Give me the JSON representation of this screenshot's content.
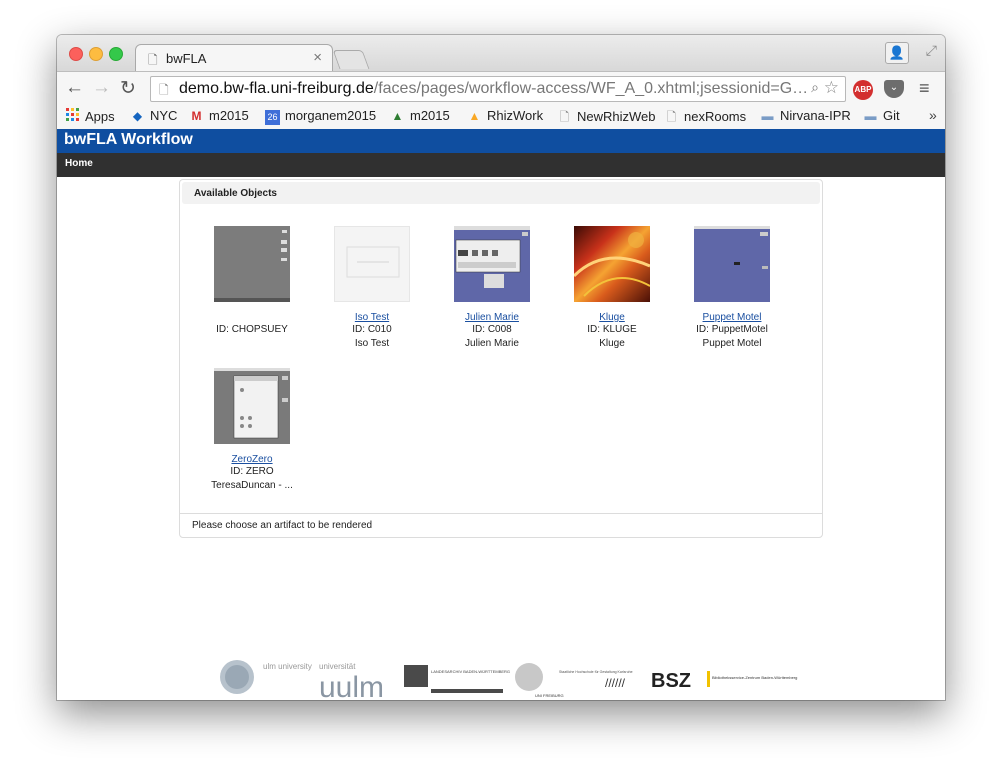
{
  "browser": {
    "tab_title": "bwFLA",
    "url_host": "demo.bw-fla.uni-freiburg.de",
    "url_path": "/faces/pages/workflow-access/WF_A_0.xhtml;jsessionid=G…",
    "abp_label": "ABP"
  },
  "bookmarks": [
    {
      "label": "Apps",
      "icon": "apps-grid-icon"
    },
    {
      "label": "NYC",
      "icon": "noaa-icon"
    },
    {
      "label": "m2015",
      "icon": "gmail-icon"
    },
    {
      "label": "morganem2015",
      "icon": "calendar-icon",
      "badge": "26"
    },
    {
      "label": "m2015",
      "icon": "drive-icon"
    },
    {
      "label": "RhizWork",
      "icon": "drive-icon"
    },
    {
      "label": "NewRhizWeb",
      "icon": "page-icon"
    },
    {
      "label": "nexRooms",
      "icon": "page-icon"
    },
    {
      "label": "Nirvana-IPR",
      "icon": "folder-icon"
    },
    {
      "label": "Git",
      "icon": "folder-icon"
    }
  ],
  "app": {
    "title": "bwFLA Workflow",
    "menu_home": "Home"
  },
  "panel": {
    "title": "Available Objects",
    "footer": "Please choose an artifact to be rendered"
  },
  "objects": [
    {
      "name": "",
      "id": "ID: CHOPSUEY",
      "desc": ""
    },
    {
      "name": "Iso Test",
      "id": "ID: C010",
      "desc": "Iso Test"
    },
    {
      "name": "Julien Marie",
      "id": "ID: C008",
      "desc": "Julien Marie"
    },
    {
      "name": "Kluge",
      "id": "ID: KLUGE",
      "desc": "Kluge"
    },
    {
      "name": "Puppet Motel",
      "id": "ID: PuppetMotel",
      "desc": "Puppet Motel"
    },
    {
      "name": "ZeroZero",
      "id": "ID: ZERO",
      "desc": "TeresaDuncan - ..."
    }
  ],
  "footer_logos": {
    "ulm_small": "ulm university",
    "ulm_small2": "universität",
    "ulm_big": "uulm",
    "landesarchiv": "LANDESARCHIV BADEN-WÜRTTEMBERG",
    "freiburg": "UNI FREIBURG",
    "karlsruhe": "Staatliche Hochschule für Gestaltung Karlsruhe",
    "bsz": "BSZ",
    "bsz_sub": "Bibliotheksservice-Zentrum Baden-Württemberg"
  }
}
